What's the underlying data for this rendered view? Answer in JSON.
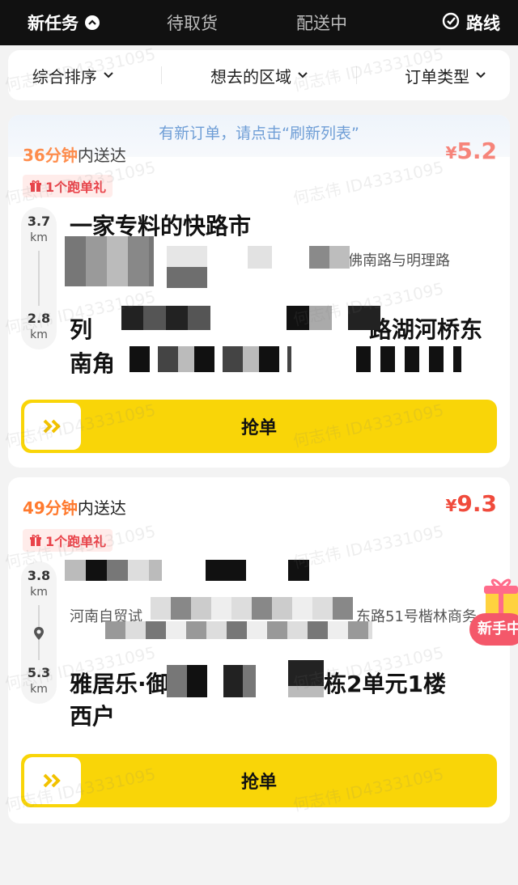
{
  "tabs": [
    {
      "label": "新任务"
    },
    {
      "label": "待取货"
    },
    {
      "label": "配送中"
    },
    {
      "label": "路线"
    }
  ],
  "filters": [
    {
      "label": "综合排序"
    },
    {
      "label": "想去的区域"
    },
    {
      "label": "订单类型"
    }
  ],
  "refresh_banner": "有新订单，请点击“刷新列表”",
  "orders": [
    {
      "eta_minutes": "36",
      "eta_unit": "分钟",
      "eta_suffix": "内送达",
      "price_symbol": "¥",
      "price": "5.2",
      "gift_tag": "1个跑单礼",
      "pickup_distance": "3.7",
      "pickup_unit": "km",
      "pickup_title": "一家专料的快路市",
      "pickup_sub": "佛南路与明理路",
      "drop_distance": "2.8",
      "drop_unit": "km",
      "drop_title_1": "列",
      "drop_title_2": "路湖河桥东",
      "drop_title_3": "南角"
    },
    {
      "eta_minutes": "49",
      "eta_unit": "分钟",
      "eta_suffix": "内送达",
      "price_symbol": "¥",
      "price": "9.3",
      "gift_tag": "1个跑单礼",
      "pickup_distance": "3.8",
      "pickup_unit": "km",
      "pickup_sub_left": "河南自贸试",
      "pickup_sub_right": "东路51号楷林商务",
      "drop_distance": "5.3",
      "drop_unit": "km",
      "drop_title_1": "雅居乐·御宾",
      "drop_title_2": "栋2单元1楼",
      "drop_title_3": "西户"
    }
  ],
  "grab_label": "抢单",
  "newbie_badge": "新手中",
  "watermark": "何志伟 ID43331095",
  "colors": {
    "topbar": "#111111",
    "accent_yellow": "#f9d508",
    "price_red": "#f04b3c",
    "eta_orange": "#ff7a2e",
    "gift_red": "#e9434a",
    "banner_blue": "#6f9ed6"
  }
}
